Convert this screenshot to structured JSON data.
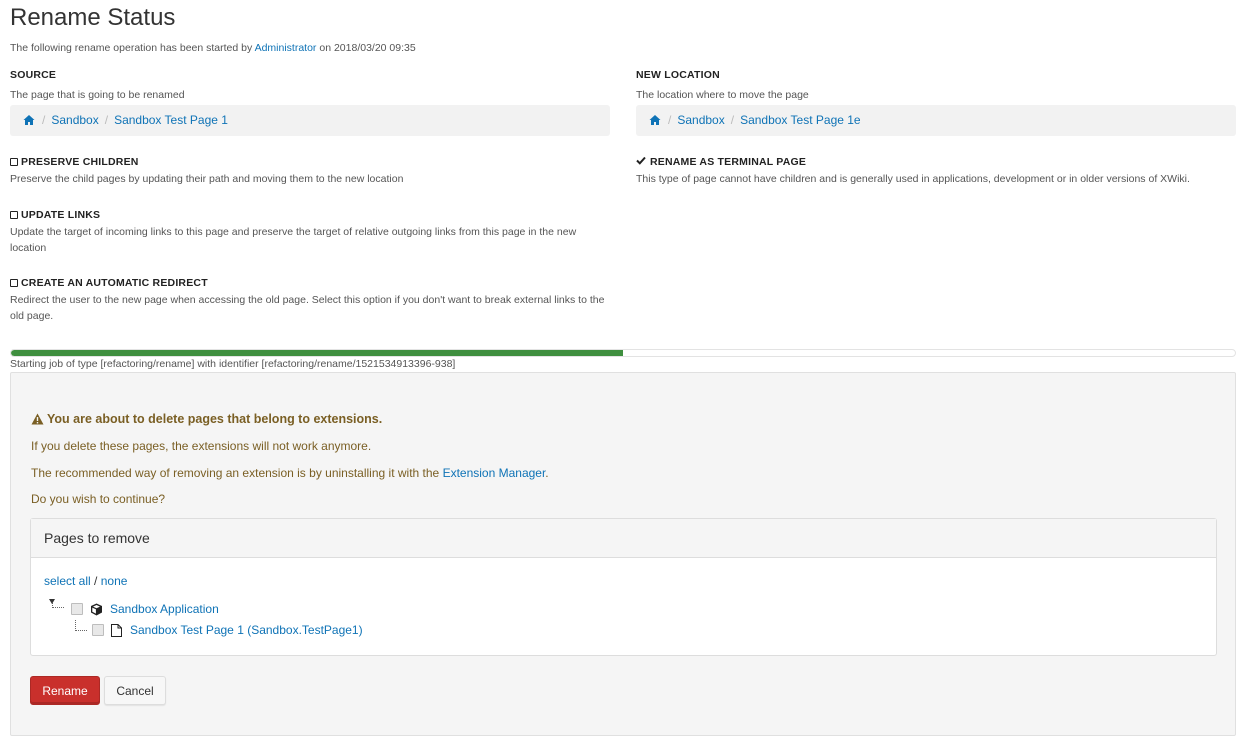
{
  "header": {
    "title": "Rename Status",
    "started_prefix": "The following rename operation has been started by",
    "started_user": "Administrator",
    "started_suffix": "on 2018/03/20 09:35"
  },
  "source": {
    "label": "SOURCE",
    "hint": "The page that is going to be renamed",
    "breadcrumb": [
      "Sandbox",
      "Sandbox Test Page 1"
    ]
  },
  "new_location": {
    "label": "NEW LOCATION",
    "hint": "The location where to move the page",
    "breadcrumb": [
      "Sandbox",
      "Sandbox Test Page 1e"
    ]
  },
  "options": {
    "preserve_children": {
      "label": "PRESERVE CHILDREN",
      "checked": false,
      "hint": "Preserve the child pages by updating their path and moving them to the new location"
    },
    "update_links": {
      "label": "UPDATE LINKS",
      "checked": false,
      "hint": "Update the target of incoming links to this page and preserve the target of relative outgoing links from this page in the new location"
    },
    "auto_redirect": {
      "label": "CREATE AN AUTOMATIC REDIRECT",
      "checked": false,
      "hint": "Redirect the user to the new page when accessing the old page. Select this option if you don't want to break external links to the old page."
    },
    "terminal_page": {
      "label": "RENAME AS TERMINAL PAGE",
      "checked": true,
      "hint": "This type of page cannot have children and is generally used in applications, development or in older versions of XWiki."
    }
  },
  "progress": {
    "fraction": 0.5,
    "text": "Starting job of type [refactoring/rename] with identifier [refactoring/rename/1521534913396-938]",
    "color": "#3f8f3f"
  },
  "warning": {
    "title": "You are about to delete pages that belong to extensions.",
    "line1": "If you delete these pages, the extensions will not work anymore.",
    "line2_prefix": "The recommended way of removing an extension is by uninstalling it with the",
    "line2_link": "Extension Manager",
    "line2_suffix": ".",
    "line3": "Do you wish to continue?",
    "color": "#7a5f24"
  },
  "pages_to_remove": {
    "heading": "Pages to remove",
    "select_all": "select all",
    "separator": "/",
    "select_none": "none",
    "tree": [
      {
        "label": "Sandbox Application",
        "icon": "extension-icon"
      },
      {
        "label": "Sandbox Test Page 1 (Sandbox.TestPage1)",
        "icon": "page-icon"
      }
    ]
  },
  "actions": {
    "rename": "Rename",
    "cancel": "Cancel",
    "rename_color": "#c9302c"
  }
}
